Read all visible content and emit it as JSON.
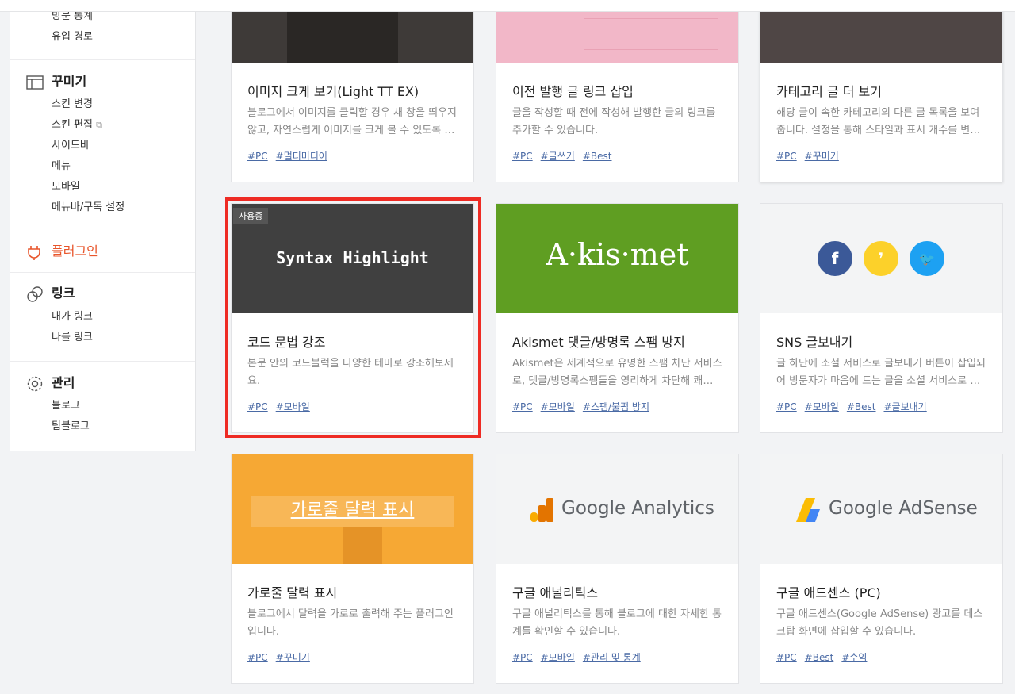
{
  "sidebar": {
    "stats_items": [
      "방문 통계",
      "유입 경로"
    ],
    "decorate": {
      "title": "꾸미기",
      "items": [
        "스킨 변경",
        "스킨 편집",
        "사이드바",
        "메뉴",
        "모바일",
        "메뉴바/구독 설정"
      ]
    },
    "plugin": {
      "title": "플러그인"
    },
    "link": {
      "title": "링크",
      "items": [
        "내가 링크",
        "나를 링크"
      ]
    },
    "manage": {
      "title": "관리",
      "items": [
        "블로그",
        "팀블로그"
      ]
    }
  },
  "cards": [
    {
      "title": "이미지 크게 보기(Light TT EX)",
      "desc": "블로그에서 이미지를 클릭할 경우 새 창을 띄우지 않고, 자연스럽게 이미지를 크게 볼 수 있도록 …",
      "tags": [
        "#PC",
        "#멀티미디어"
      ]
    },
    {
      "title": "이전 발행 글 링크 삽입",
      "desc": "글을 작성할 때 전에 작성해 발행한 글의 링크를 추가할 수 있습니다.",
      "tags": [
        "#PC",
        "#글쓰기",
        "#Best"
      ]
    },
    {
      "title": "카테고리 글 더 보기",
      "desc": "해당 글이 속한 카테고리의 다른 글 목록을 보여줍니다. 설정을 통해 스타일과 표시 개수를 변…",
      "tags": [
        "#PC",
        "#꾸미기"
      ]
    },
    {
      "title": "코드 문법 강조",
      "desc": "본문 안의 코드블럭을 다양한 테마로 강조해보세요.",
      "tags": [
        "#PC",
        "#모바일"
      ],
      "badge": "사용중",
      "thumb_text": "Syntax Highlight"
    },
    {
      "title": "Akismet 댓글/방명록 스팸 방지",
      "desc": "Akismet은 세계적으로 유명한 스팸 차단 서비스로, 댓글/방명록스팸들을 영리하게 차단해 쾌…",
      "tags": [
        "#PC",
        "#모바일",
        "#스팸/불펌 방지"
      ],
      "thumb_text": "A·kis·met"
    },
    {
      "title": "SNS 글보내기",
      "desc": "글 하단에 소셜 서비스로 글보내기 버튼이 삽입되어 방문자가 마음에 드는 글을 소셜 서비스로 …",
      "tags": [
        "#PC",
        "#모바일",
        "#Best",
        "#글보내기"
      ]
    },
    {
      "title": "가로줄 달력 표시",
      "desc": "블로그에서 달력을 가로로 출력해 주는 플러그인입니다.",
      "tags": [
        "#PC",
        "#꾸미기"
      ],
      "thumb_text": "가로줄 달력 표시"
    },
    {
      "title": "구글 애널리틱스",
      "desc": "구글 애널리틱스를 통해 블로그에 대한 자세한 통계를 확인할 수 있습니다.",
      "tags": [
        "#PC",
        "#모바일",
        "#관리 및 통계"
      ],
      "thumb_text": "Google Analytics"
    },
    {
      "title": "구글 애드센스 (PC)",
      "desc": "구글 애드센스(Google AdSense) 광고를 데스크탑 화면에 삽입할 수 있습니다.",
      "tags": [
        "#PC",
        "#Best",
        "#수익"
      ],
      "thumb_text": "Google AdSense"
    }
  ],
  "colors": {
    "accent": "#e8552b",
    "tag": "#4a6aa5",
    "highlight": "#ee2b24",
    "akismet": "#5f9e22",
    "calendar": "#f6a834"
  }
}
